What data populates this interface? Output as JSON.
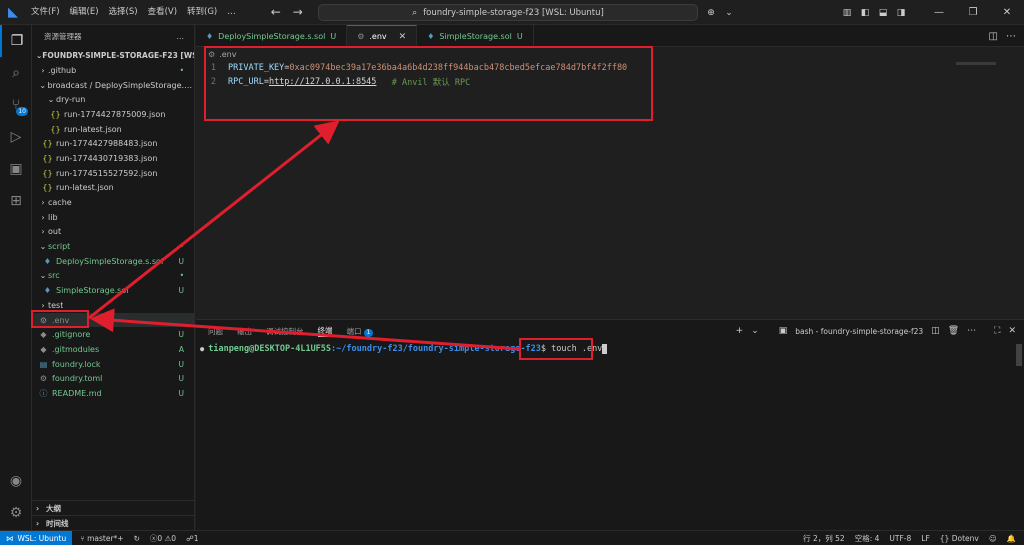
{
  "titlebar": {
    "menu": [
      "文件(F)",
      "编辑(E)",
      "选择(S)",
      "查看(V)",
      "转到(G)"
    ],
    "more": "…",
    "search": "foundry-simple-storage-f23 [WSL: Ubuntu]"
  },
  "sidebar": {
    "header": "资源管理器",
    "more": "…",
    "root": "FOUNDRY-SIMPLE-STORAGE-F23 [WSL: ...",
    "items": [
      {
        "label": ".github",
        "status": "•"
      },
      {
        "label": "broadcast / DeploySimpleStorage.s.s...",
        "status": ""
      },
      {
        "label": "dry-run",
        "status": ""
      },
      {
        "label": "run-1774427875009.json",
        "status": ""
      },
      {
        "label": "run-latest.json",
        "status": ""
      },
      {
        "label": "run-1774427988483.json",
        "status": ""
      },
      {
        "label": "run-1774430719383.json",
        "status": ""
      },
      {
        "label": "run-1774515527592.json",
        "status": ""
      },
      {
        "label": "run-latest.json",
        "status": ""
      },
      {
        "label": "cache",
        "status": ""
      },
      {
        "label": "lib",
        "status": ""
      },
      {
        "label": "out",
        "status": ""
      },
      {
        "label": "script",
        "status": "•"
      },
      {
        "label": "DeploySimpleStorage.s.sol",
        "status": "U"
      },
      {
        "label": "src",
        "status": "•"
      },
      {
        "label": "SimpleStorage.sol",
        "status": "U"
      },
      {
        "label": "test",
        "status": ""
      },
      {
        "label": ".env",
        "status": ""
      },
      {
        "label": ".gitignore",
        "status": "U"
      },
      {
        "label": ".gitmodules",
        "status": "A"
      },
      {
        "label": "foundry.lock",
        "status": "U"
      },
      {
        "label": "foundry.toml",
        "status": "U"
      },
      {
        "label": "README.md",
        "status": "U"
      }
    ],
    "outline": "大纲",
    "timeline": "时间线"
  },
  "tabs": [
    {
      "label": "DeploySimpleStorage.s.sol",
      "status": "U"
    },
    {
      "label": ".env",
      "status": ""
    },
    {
      "label": "SimpleStorage.sol",
      "status": "U"
    }
  ],
  "editor": {
    "breadcrumb": ".env",
    "lines": [
      {
        "num": "1",
        "key": "PRIVATE_KEY",
        "eq": "=",
        "value": "0xac0974bec39a17e36ba4a6b4d238ff944bacb478cbed5efcae784d7bf4f2ff80",
        "comment": ""
      },
      {
        "num": "2",
        "key": "RPC_URL",
        "eq": "=",
        "value": "http://127.0.0.1:8545",
        "comment": "   # Anvil 默认 RPC"
      }
    ]
  },
  "panel": {
    "tabs": [
      "问题",
      "输出",
      "调试控制台",
      "终端",
      "端口"
    ],
    "ports_badge": "1",
    "terminal_name": "bash - foundry-simple-storage-f23",
    "prompt_user": "tianpeng@DESKTOP-4L1UF5S",
    "prompt_path": ":~/foundry-f23/foundry-simple-storage-f23",
    "prompt_symbol": "$ ",
    "command": "touch .env"
  },
  "statusbar": {
    "remote": "WSL: Ubuntu",
    "branch": "master*+",
    "sync": "↻",
    "errors": "0",
    "warnings": "0",
    "ports": "1",
    "position": "行 2，列 52",
    "spaces": "空格: 4",
    "encoding": "UTF-8",
    "eol": "LF",
    "language": "Dotenv"
  },
  "colors": {
    "accent": "#0078d4",
    "annotation": "#e01e2d",
    "untracked": "#73c991"
  }
}
